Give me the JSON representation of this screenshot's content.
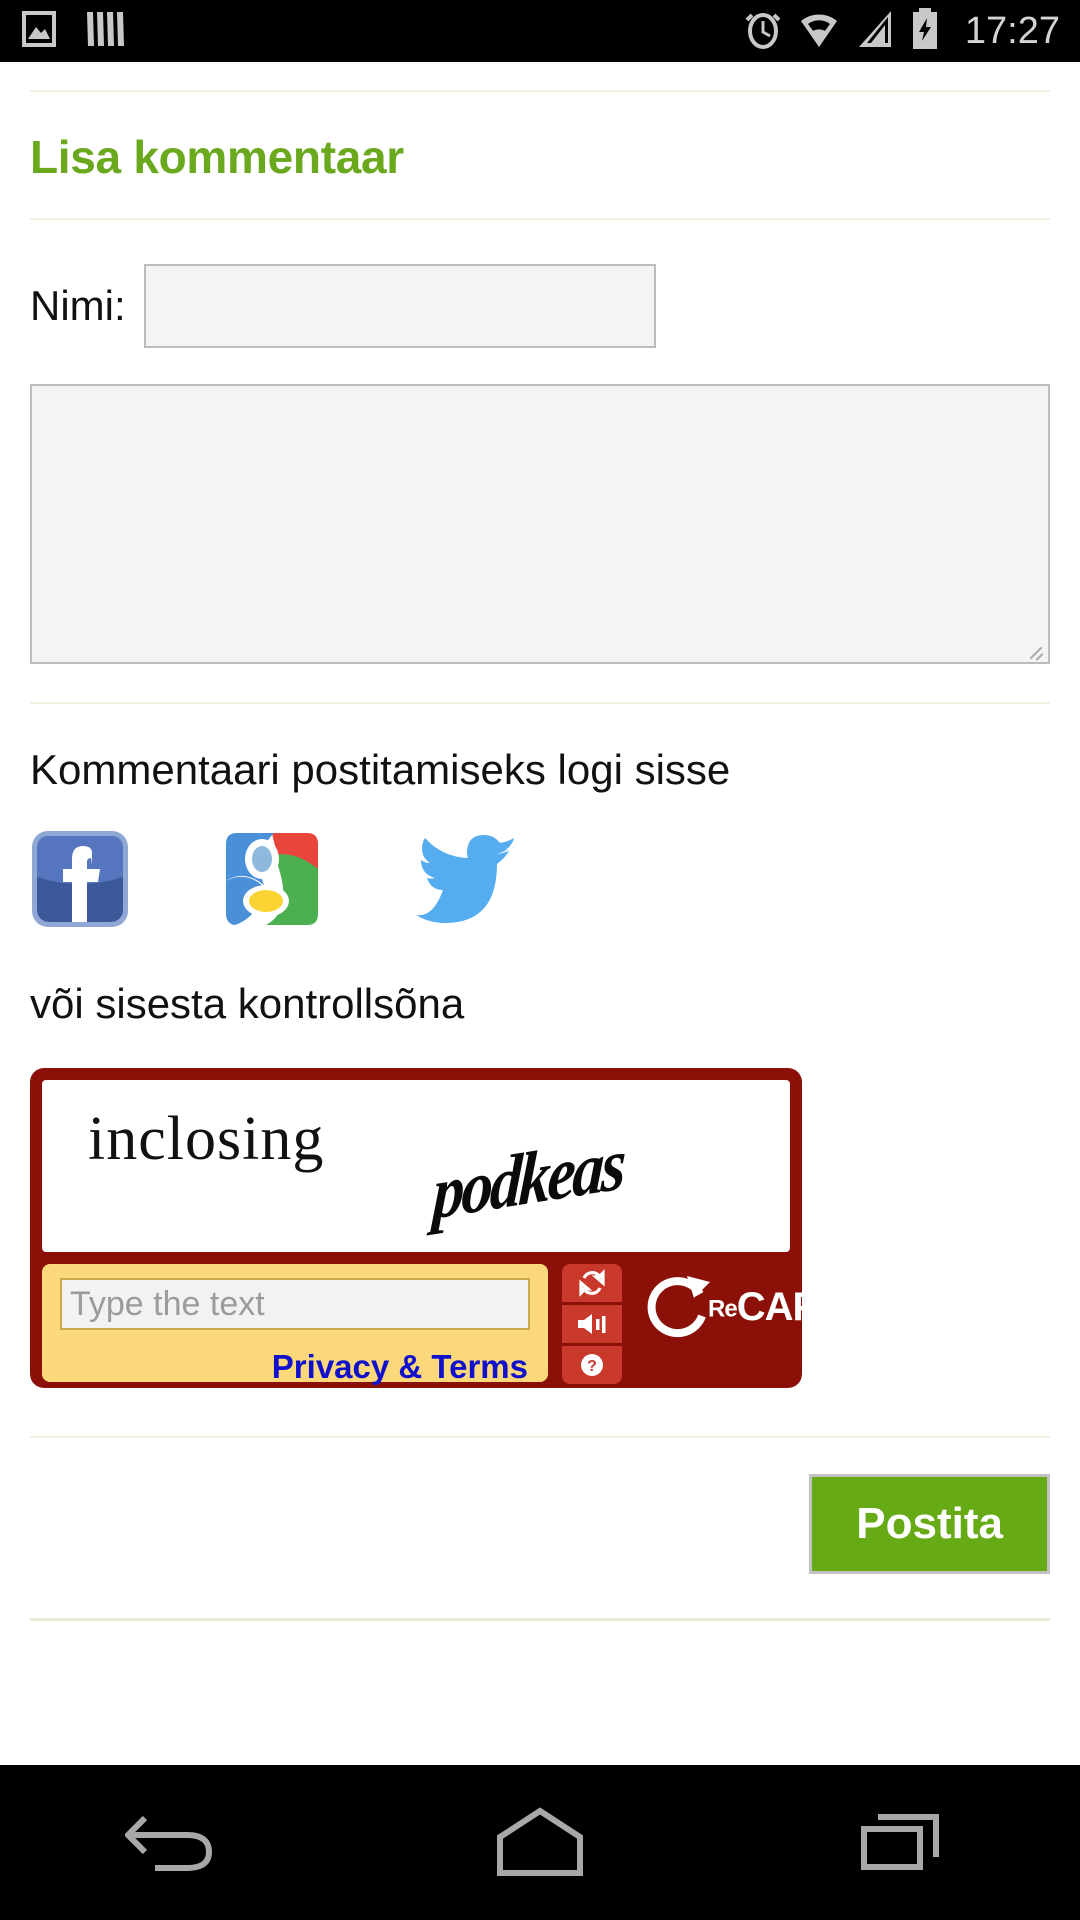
{
  "statusbar": {
    "time": "17:27",
    "left_icons": [
      {
        "name": "gallery-image-icon"
      },
      {
        "name": "barcode-icon"
      }
    ],
    "right_icons": [
      {
        "name": "alarm-clock-icon"
      },
      {
        "name": "wifi-icon"
      },
      {
        "name": "cellular-signal-icon"
      },
      {
        "name": "battery-charging-icon"
      }
    ]
  },
  "form": {
    "title": "Lisa kommentaar",
    "name_label": "Nimi:",
    "name_value": "",
    "name_placeholder": "",
    "comment_value": "",
    "comment_placeholder": "",
    "login_prompt": "Kommentaari postitamiseks logi sisse",
    "social": [
      {
        "name": "facebook-login-icon",
        "label": "Facebook"
      },
      {
        "name": "google-login-icon",
        "label": "Google"
      },
      {
        "name": "twitter-login-icon",
        "label": "Twitter"
      }
    ],
    "captcha_label": "või sisesta kontrollsõna",
    "submit_label": "Postita"
  },
  "recaptcha": {
    "word_printed": "inclosing",
    "word_distorted": "podkeas",
    "input_value": "",
    "input_placeholder": "Type the text",
    "privacy_link": "Privacy & Terms",
    "logo_re": "Re",
    "logo_captcha": "CAPTCHA",
    "logo_tm": "™",
    "controls": [
      {
        "name": "refresh-challenge-button"
      },
      {
        "name": "audio-challenge-button"
      },
      {
        "name": "help-button"
      }
    ]
  },
  "navbar": {
    "back_label": "Back",
    "home_label": "Home",
    "recents_label": "Recents"
  },
  "colors": {
    "title_green": "#6aa81e",
    "button_green": "#66aa16",
    "recaptcha_red": "#8b1007",
    "recaptcha_btn_red": "#c8392b",
    "captcha_yellow": "#fbd87a",
    "link_blue": "#1111cc",
    "twitter_blue": "#55acee",
    "facebook_blue": "#3b5998"
  }
}
